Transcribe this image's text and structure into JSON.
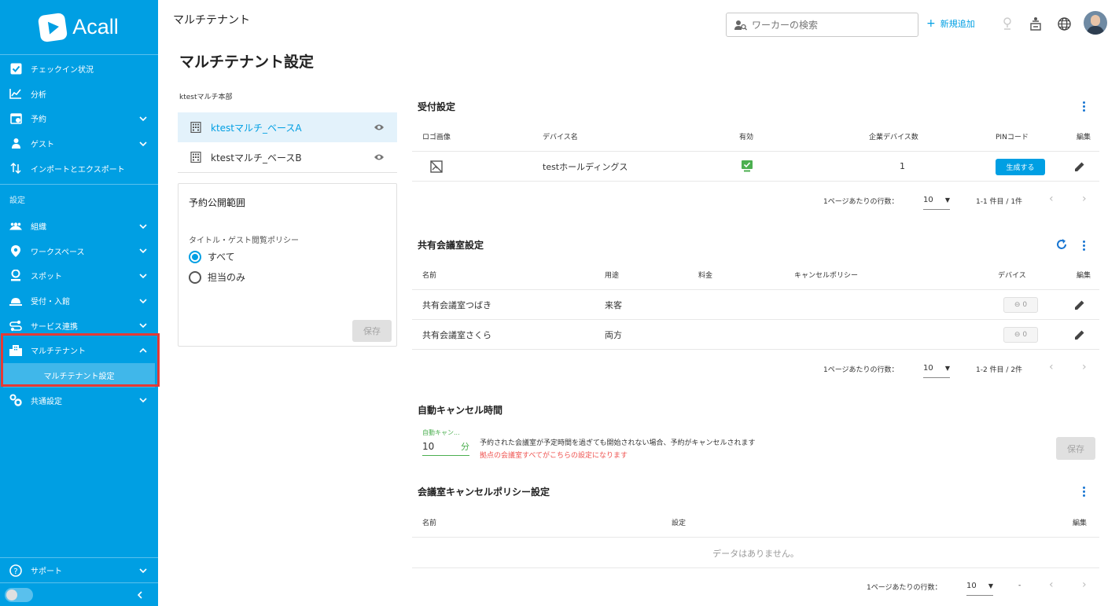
{
  "app": {
    "logo_text": "Acall"
  },
  "colors": {
    "brand": "#009fe3",
    "highlight": "#e53935",
    "valid": "#4caf50",
    "warning_text": "#ef5350"
  },
  "sidebar": {
    "items_top": [
      {
        "label": "チェックイン状況",
        "icon": "checkbox-icon"
      },
      {
        "label": "分析",
        "icon": "chart-line-icon"
      },
      {
        "label": "予約",
        "icon": "calendar-icon"
      },
      {
        "label": "ゲスト",
        "icon": "guest-icon"
      },
      {
        "label": "インポートとエクスポート",
        "icon": "import-export-icon"
      }
    ],
    "settings_group": "設定",
    "items_settings": [
      {
        "label": "組織",
        "icon": "people-icon"
      },
      {
        "label": "ワークスペース",
        "icon": "location-pin-icon"
      },
      {
        "label": "スポット",
        "icon": "spot-pin-icon"
      },
      {
        "label": "受付・入館",
        "icon": "reception-bell-icon"
      },
      {
        "label": "サービス連携",
        "icon": "integration-icon"
      },
      {
        "label": "マルチテナント",
        "icon": "building-icon"
      }
    ],
    "sub_item": "マルチテナント設定",
    "common_settings": "共通設定",
    "support": "サポート"
  },
  "header": {
    "title": "マルチテナント",
    "search_placeholder": "ワーカーの検索",
    "new_button": "新規追加"
  },
  "page": {
    "title": "マルチテナント設定",
    "group_label": "ktestマルチ本部",
    "tenants": [
      {
        "name": "ktestマルチ_ベースA"
      },
      {
        "name": "ktestマルチ_ベースB"
      }
    ],
    "scope": {
      "title": "予約公開範囲",
      "policy_label": "タイトル・ゲスト閲覧ポリシー",
      "options": [
        "すべて",
        "担当のみ"
      ],
      "selected": "すべて",
      "save": "保存"
    }
  },
  "reception": {
    "title": "受付設定",
    "headers": [
      "ロゴ画像",
      "デバイス名",
      "有効",
      "企業デバイス数",
      "PINコード",
      "編集"
    ],
    "row": {
      "device": "testホールディングス",
      "count": "1",
      "pin_button": "生成する"
    },
    "pager": {
      "rows_label": "1ページあたりの行数：",
      "rows": "10",
      "range": "1-1 件目 / 1件"
    }
  },
  "rooms": {
    "title": "共有会議室設定",
    "headers": [
      "名前",
      "用途",
      "料金",
      "キャンセルポリシー",
      "デバイス",
      "編集"
    ],
    "rows": [
      {
        "name": "共有会議室つばき",
        "use": "来客",
        "devices": "0"
      },
      {
        "name": "共有会議室さくら",
        "use": "両方",
        "devices": "0"
      }
    ],
    "pager": {
      "rows_label": "1ページあたりの行数：",
      "rows": "10",
      "range": "1-2 件目 / 2件"
    }
  },
  "auto_cancel": {
    "title": "自動キャンセル時間",
    "field_label": "自動キャン...",
    "value": "10",
    "unit": "分",
    "description": "予約された会議室が予定時間を過ぎても開始されない場合、予約がキャンセルされます",
    "note": "拠点の会議室すべてがこちらの設定になります",
    "save": "保存"
  },
  "cancel_policy": {
    "title": "会議室キャンセルポリシー設定",
    "headers": [
      "名前",
      "設定",
      "編集"
    ],
    "empty": "データはありません。",
    "pager": {
      "rows_label": "1ページあたりの行数：",
      "rows": "10",
      "range": "-"
    }
  }
}
